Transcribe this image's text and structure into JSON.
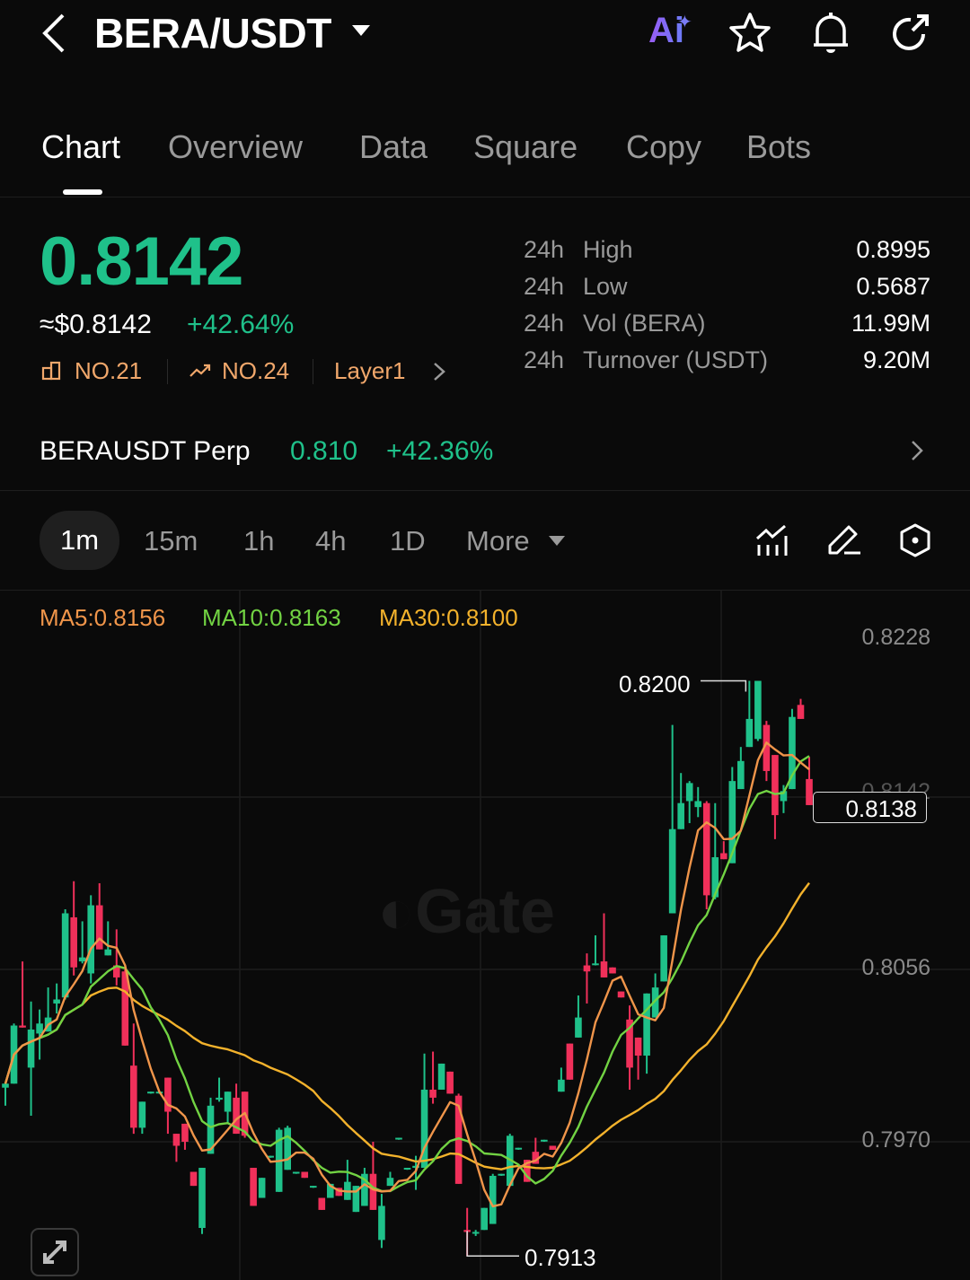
{
  "header": {
    "title": "BERA/USDT",
    "icons": [
      "back-icon",
      "caret-down-icon",
      "ai-icon",
      "star-icon",
      "bell-icon",
      "share-icon"
    ]
  },
  "tabs": [
    {
      "label": "Chart",
      "active": true
    },
    {
      "label": "Overview"
    },
    {
      "label": "Data"
    },
    {
      "label": "Square"
    },
    {
      "label": "Copy"
    },
    {
      "label": "Bots"
    }
  ],
  "ticker": {
    "last_price": "0.8142",
    "usd_price": "≈$0.8142",
    "change": "+42.64%",
    "rank_market_cap": "NO.21",
    "rank_gainers": "NO.24",
    "sector": "Layer1"
  },
  "stats": [
    {
      "period": "24h",
      "label": "High",
      "value": "0.8995"
    },
    {
      "period": "24h",
      "label": "Low",
      "value": "0.5687"
    },
    {
      "period": "24h",
      "label": "Vol (BERA)",
      "value": "11.99M"
    },
    {
      "period": "24h",
      "label": "Turnover (USDT)",
      "value": "9.20M"
    }
  ],
  "perp": {
    "name": "BERAUSDT Perp",
    "price": "0.810",
    "change": "+42.36%"
  },
  "timeframes": [
    {
      "label": "1m",
      "active": true
    },
    {
      "label": "15m"
    },
    {
      "label": "1h"
    },
    {
      "label": "4h"
    },
    {
      "label": "1D"
    },
    {
      "label": "More"
    }
  ],
  "chart_tools": [
    "indicator-icon",
    "draw-icon",
    "settings-hexagon-icon"
  ],
  "colors": {
    "up": "#1fc18a",
    "down": "#f0305a",
    "ma5": "#f0954a",
    "ma10": "#72d343",
    "ma30": "#f3b22c",
    "tag": "#f0a76b"
  },
  "chart": {
    "ma_labels": {
      "ma5": "MA5:0.8156",
      "ma10": "MA10:0.8163",
      "ma30": "MA30:0.8100"
    },
    "price_axis": [
      "0.8228",
      "0.8142",
      "0.8056",
      "0.7970"
    ],
    "high_marker": "0.8200",
    "low_marker": "0.7913",
    "current_price": "0.8138",
    "watermark": "Gate",
    "candles_ohlc": [
      [
        0.7997,
        0.7999,
        0.7988,
        0.7999
      ],
      [
        0.7999,
        0.8029,
        0.7999,
        0.8028
      ],
      [
        0.8028,
        0.806,
        0.8027,
        0.8027
      ],
      [
        0.8007,
        0.804,
        0.7983,
        0.8026
      ],
      [
        0.8024,
        0.8036,
        0.8011,
        0.8029
      ],
      [
        0.8025,
        0.8047,
        0.8025,
        0.8032
      ],
      [
        0.8039,
        0.8049,
        0.8034,
        0.8041
      ],
      [
        0.8042,
        0.8086,
        0.8041,
        0.8084
      ],
      [
        0.8082,
        0.81,
        0.8053,
        0.8057
      ],
      [
        0.806,
        0.808,
        0.8059,
        0.8062
      ],
      [
        0.8054,
        0.8093,
        0.8049,
        0.8088
      ],
      [
        0.8088,
        0.8099,
        0.8066,
        0.8066
      ],
      [
        0.8063,
        0.808,
        0.8063,
        0.8066
      ],
      [
        0.8058,
        0.8076,
        0.8048,
        0.8052
      ],
      [
        0.8055,
        0.8056,
        0.8018,
        0.8018
      ],
      [
        0.8008,
        0.8029,
        0.7974,
        0.7977
      ],
      [
        0.7977,
        0.799,
        0.7974,
        0.799
      ],
      [
        0.7995,
        0.7995,
        0.7994,
        0.7995
      ],
      [
        0.7995,
        0.7995,
        0.7994,
        0.7995
      ],
      [
        0.8002,
        0.8002,
        0.7974,
        0.7985
      ],
      [
        0.7974,
        0.7974,
        0.796,
        0.7968
      ],
      [
        0.7979,
        0.7979,
        0.7966,
        0.797
      ],
      [
        0.7955,
        0.7955,
        0.7948,
        0.7948
      ],
      [
        0.7927,
        0.7957,
        0.7924,
        0.7957
      ],
      [
        0.7964,
        0.7992,
        0.7964,
        0.7988
      ],
      [
        0.7991,
        0.8002,
        0.799,
        0.7992
      ],
      [
        0.7985,
        0.7995,
        0.7979,
        0.7995
      ],
      [
        0.7992,
        0.7999,
        0.7974,
        0.7974
      ],
      [
        0.7995,
        0.7995,
        0.7972,
        0.7973
      ],
      [
        0.7957,
        0.7957,
        0.7938,
        0.7938
      ],
      [
        0.7942,
        0.7952,
        0.7942,
        0.7952
      ],
      [
        0.7963,
        0.7963,
        0.7962,
        0.7963
      ],
      [
        0.7945,
        0.7977,
        0.7945,
        0.7976
      ],
      [
        0.7956,
        0.7978,
        0.7956,
        0.7977
      ],
      [
        0.7955,
        0.7955,
        0.7954,
        0.7955
      ],
      [
        0.7955,
        0.7955,
        0.7952,
        0.7952
      ],
      [
        0.7948,
        0.7948,
        0.7947,
        0.7948
      ],
      [
        0.7942,
        0.7942,
        0.7936,
        0.7936
      ],
      [
        0.7942,
        0.7949,
        0.7942,
        0.7949
      ],
      [
        0.7947,
        0.7947,
        0.7943,
        0.7943
      ],
      [
        0.7941,
        0.7961,
        0.7941,
        0.795
      ],
      [
        0.7935,
        0.7948,
        0.7935,
        0.7948
      ],
      [
        0.7938,
        0.7957,
        0.7938,
        0.7954
      ],
      [
        0.7954,
        0.797,
        0.7936,
        0.7936
      ],
      [
        0.7921,
        0.7944,
        0.7917,
        0.7938
      ],
      [
        0.7948,
        0.7955,
        0.7948,
        0.7952
      ],
      [
        0.7972,
        0.7972,
        0.7971,
        0.7972
      ],
      [
        0.7957,
        0.7957,
        0.7956,
        0.7957
      ],
      [
        0.7957,
        0.7963,
        0.7946,
        0.7958
      ],
      [
        0.7957,
        0.8014,
        0.7957,
        0.7996
      ],
      [
        0.7996,
        0.8015,
        0.7989,
        0.7992
      ],
      [
        0.7996,
        0.8009,
        0.7996,
        0.8009
      ],
      [
        0.8005,
        0.8005,
        0.7994,
        0.7994
      ],
      [
        0.7993,
        0.7994,
        0.7949,
        0.7949
      ],
      [
        0.7926,
        0.7937,
        0.7913,
        0.7925
      ],
      [
        0.7925,
        0.7926,
        0.7923,
        0.7925
      ],
      [
        0.7926,
        0.7937,
        0.7926,
        0.7937
      ],
      [
        0.7929,
        0.7954,
        0.7929,
        0.7953
      ],
      [
        0.7954,
        0.7954,
        0.7953,
        0.7954
      ],
      [
        0.7948,
        0.7974,
        0.7948,
        0.7973
      ],
      [
        0.7967,
        0.7967,
        0.7966,
        0.7967
      ],
      [
        0.7961,
        0.7961,
        0.795,
        0.795
      ],
      [
        0.7965,
        0.7972,
        0.7959,
        0.7959
      ],
      [
        0.7971,
        0.7971,
        0.797,
        0.7971
      ],
      [
        0.7968,
        0.7968,
        0.7966,
        0.7966
      ],
      [
        0.7995,
        0.8007,
        0.7995,
        0.8001
      ],
      [
        0.8019,
        0.8019,
        0.8001,
        0.8001
      ],
      [
        0.8022,
        0.8043,
        0.8022,
        0.8032
      ],
      [
        0.8058,
        0.8064,
        0.8039,
        0.8055
      ],
      [
        0.8059,
        0.8073,
        0.8058,
        0.8059
      ],
      [
        0.806,
        0.8084,
        0.8052,
        0.8052
      ],
      [
        0.8057,
        0.8057,
        0.8054,
        0.8054
      ],
      [
        0.8045,
        0.8045,
        0.8042,
        0.8042
      ],
      [
        0.8031,
        0.8038,
        0.7996,
        0.8007
      ],
      [
        0.8022,
        0.8022,
        0.8001,
        0.8013
      ],
      [
        0.8013,
        0.8044,
        0.8004,
        0.8044
      ],
      [
        0.8032,
        0.8054,
        0.8032,
        0.8047
      ],
      [
        0.805,
        0.8073,
        0.805,
        0.8073
      ],
      [
        0.8084,
        0.8178,
        0.8084,
        0.8126
      ],
      [
        0.8126,
        0.8154,
        0.8126,
        0.8139
      ],
      [
        0.814,
        0.815,
        0.8129,
        0.8149
      ],
      [
        0.8137,
        0.8147,
        0.8132,
        0.814
      ],
      [
        0.8139,
        0.814,
        0.8086,
        0.8093
      ],
      [
        0.8092,
        0.8139,
        0.8091,
        0.8112
      ],
      [
        0.8114,
        0.812,
        0.8111,
        0.8111
      ],
      [
        0.8109,
        0.8157,
        0.8109,
        0.815
      ],
      [
        0.8146,
        0.8167,
        0.8146,
        0.816
      ],
      [
        0.8167,
        0.82,
        0.8167,
        0.8181
      ],
      [
        0.8171,
        0.82,
        0.817,
        0.82
      ],
      [
        0.8178,
        0.818,
        0.815,
        0.8155
      ],
      [
        0.8163,
        0.8163,
        0.8121,
        0.8133
      ],
      [
        0.814,
        0.8148,
        0.8134,
        0.8145
      ],
      [
        0.8146,
        0.8186,
        0.8146,
        0.8182
      ],
      [
        0.8188,
        0.8191,
        0.8181,
        0.8181
      ],
      [
        0.8151,
        0.8162,
        0.8138,
        0.8138
      ]
    ]
  }
}
